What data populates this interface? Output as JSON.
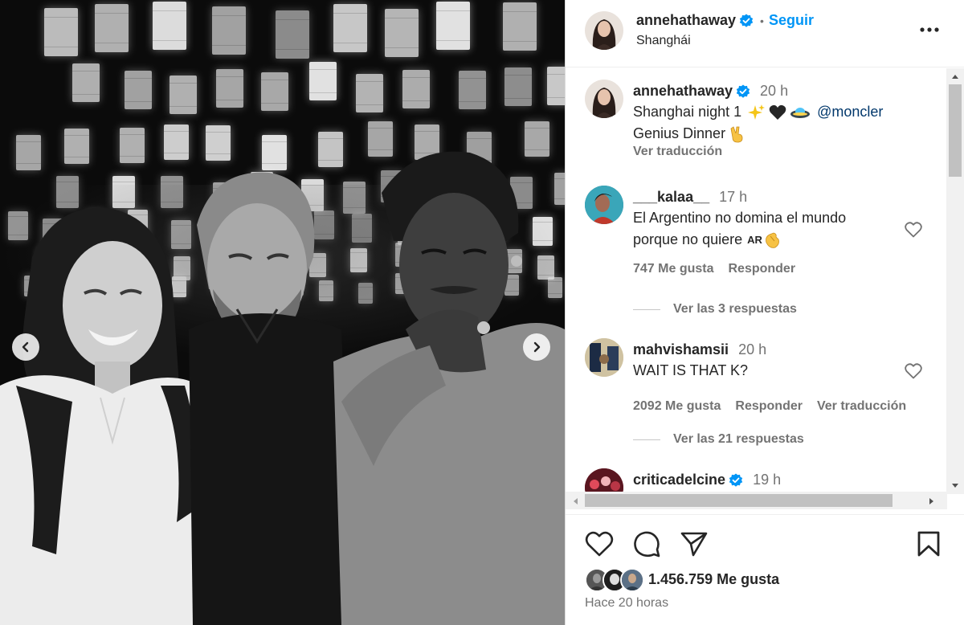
{
  "post": {
    "author": "annehathaway",
    "location": "Shanghái",
    "follow_label": "Seguir",
    "more_icon": "more-options-icon"
  },
  "caption": {
    "author": "annehathaway",
    "time": "20 h",
    "line1_text": "Shanghai night 1",
    "mention": "@moncler",
    "line2_text": "Genius Dinner",
    "translate_label": "Ver traducción"
  },
  "comments": [
    {
      "author": "___kalaa__",
      "time": "17 h",
      "line1": "El Argentino no domina el mundo",
      "line2": "porque no quiere",
      "flag": "AR",
      "likes": "747 Me gusta",
      "reply_label": "Responder",
      "view_replies": "Ver las 3 respuestas"
    },
    {
      "author": "mahvishamsii",
      "time": "20 h",
      "text": "WAIT IS THAT K?",
      "likes": "2092 Me gusta",
      "reply_label": "Responder",
      "translate_label": "Ver traducción",
      "view_replies": "Ver las 21 respuestas"
    },
    {
      "author": "criticadelcine",
      "time": "19 h"
    }
  ],
  "footer": {
    "likes": "1.456.759 Me gusta",
    "time_ago": "Hace 20 horas"
  },
  "colors": {
    "accent": "#0095f6",
    "verified": "#0095f6",
    "mention": "#00376b",
    "text": "#262626",
    "muted": "#737373"
  }
}
